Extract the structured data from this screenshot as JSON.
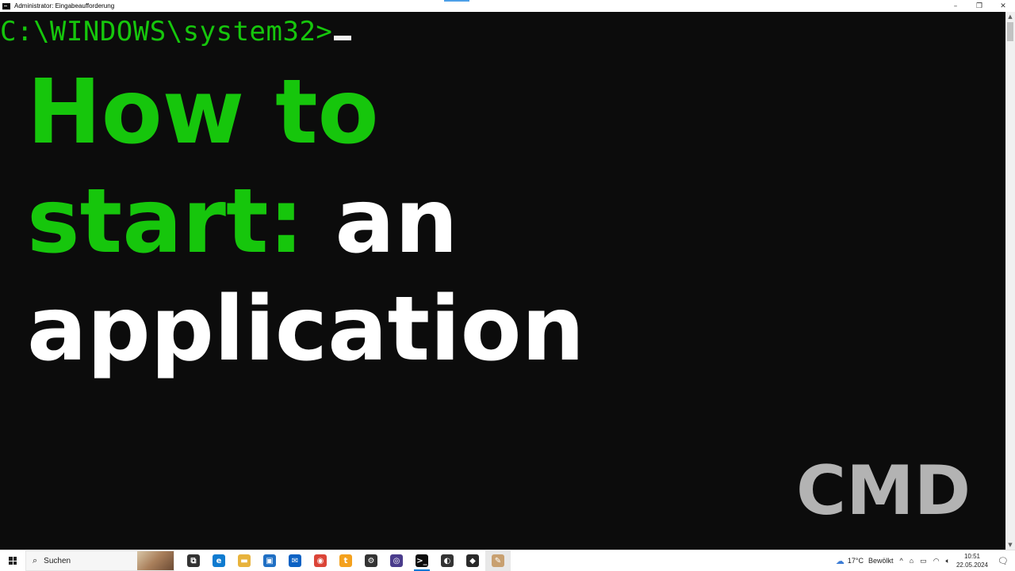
{
  "window": {
    "title": "Administrator: Eingabeaufforderung",
    "controls": {
      "minimize": "–",
      "maximize": "❐",
      "close": "✕"
    }
  },
  "console": {
    "prompt": "C:\\WINDOWS\\system32>",
    "headline": {
      "line1_green": "How to",
      "line2_green": "start:",
      "line2_white": " an",
      "line3_white": "application"
    },
    "watermark": "CMD",
    "colors": {
      "green": "#16c60c",
      "white": "#ffffff",
      "background": "#0c0c0c",
      "watermark": "#b3b3b3"
    }
  },
  "scrollbar": {
    "up_arrow": "▲",
    "down_arrow": "▼"
  },
  "taskbar": {
    "search_placeholder": "Suchen",
    "search_icon": "⌕",
    "apps": [
      {
        "name": "task-view-icon",
        "glyph": "⧉",
        "color": "#333333"
      },
      {
        "name": "edge-icon",
        "glyph": "e",
        "color": "#0f7bd0"
      },
      {
        "name": "file-explorer-icon",
        "glyph": "▬",
        "color": "#e8b33c"
      },
      {
        "name": "store-icon",
        "glyph": "▣",
        "color": "#1f6fc4"
      },
      {
        "name": "mail-icon",
        "glyph": "✉",
        "color": "#0b62c4"
      },
      {
        "name": "chrome-icon",
        "glyph": "◉",
        "color": "#db4437"
      },
      {
        "name": "app-t-icon",
        "glyph": "t",
        "color": "#f4a11d"
      },
      {
        "name": "settings-icon",
        "glyph": "⚙",
        "color": "#333333"
      },
      {
        "name": "obs-icon",
        "glyph": "◎",
        "color": "#4a3c8c"
      },
      {
        "name": "cmd-icon",
        "glyph": ">_",
        "color": "#0c0c0c"
      },
      {
        "name": "app-dark-icon",
        "glyph": "◐",
        "color": "#333333"
      },
      {
        "name": "davinci-icon",
        "glyph": "◆",
        "color": "#2a2a2a"
      },
      {
        "name": "paint-icon",
        "glyph": "✎",
        "color": "#c8a070"
      }
    ],
    "tray": {
      "weather_temp": "17°C",
      "weather_text": "Bewölkt",
      "chevron": "^",
      "time": "10:51",
      "date": "22.05.2024"
    }
  }
}
